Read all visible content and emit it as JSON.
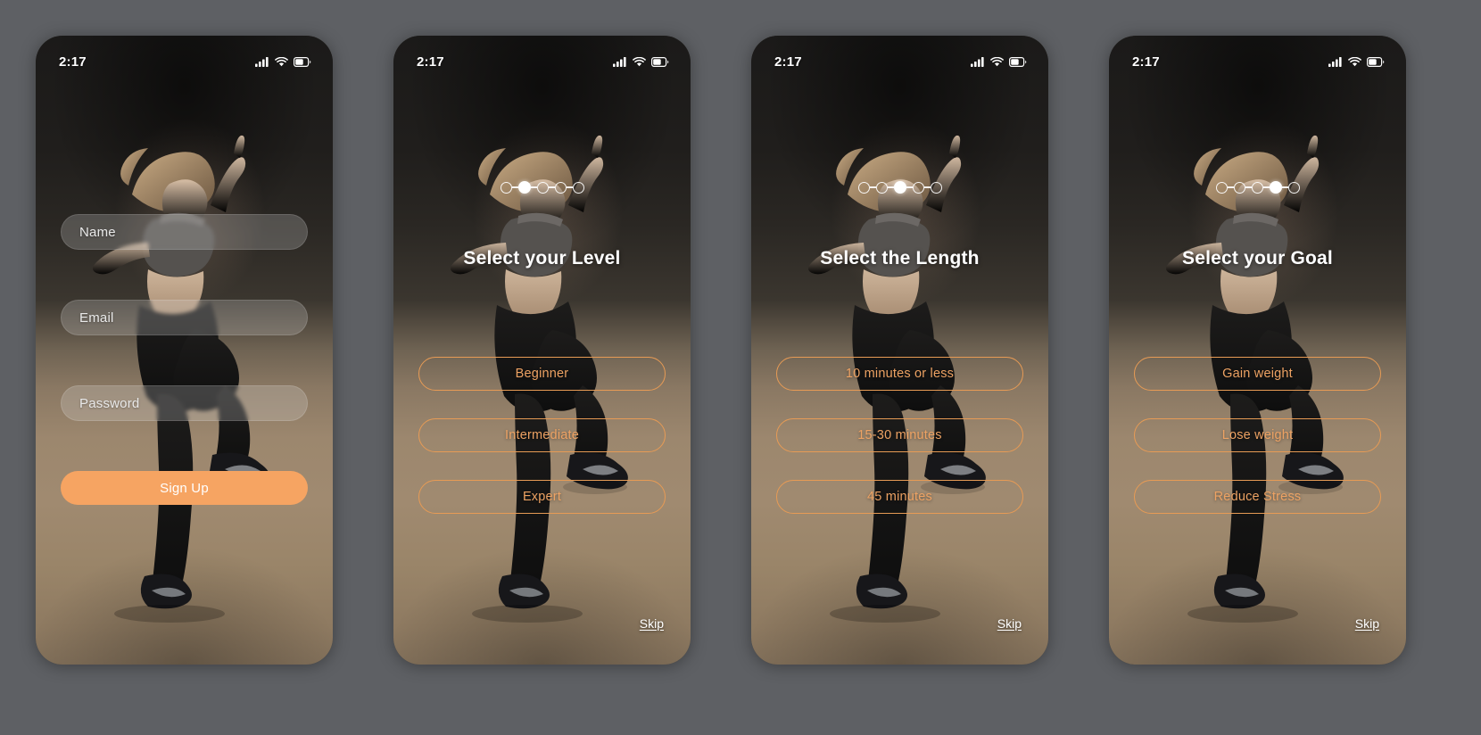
{
  "theme": {
    "accent": "#f6a462",
    "outline": "#e79b55",
    "option_text": "#eda263",
    "page_background": "#5e6064",
    "title_color": "#ffffff"
  },
  "status_bar": {
    "time": "2:17",
    "icons": [
      "cellular-signal-icon",
      "wifi-icon",
      "battery-icon"
    ]
  },
  "screens": [
    {
      "id": "signup",
      "kind": "form",
      "progress": null,
      "title": null,
      "fields": [
        {
          "name": "name-field",
          "placeholder": "Name",
          "value": ""
        },
        {
          "name": "email-field",
          "placeholder": "Email",
          "value": ""
        },
        {
          "name": "password-field",
          "placeholder": "Password",
          "value": ""
        }
      ],
      "primary_button": "Sign Up",
      "skip": null
    },
    {
      "id": "level",
      "kind": "choice",
      "progress": {
        "total": 5,
        "active_index": 1
      },
      "title": "Select your Level",
      "options": [
        "Beginner",
        "Intermediate",
        "Expert"
      ],
      "skip": "Skip"
    },
    {
      "id": "length",
      "kind": "choice",
      "progress": {
        "total": 5,
        "active_index": 2
      },
      "title": "Select the Length",
      "options": [
        "10 minutes or less",
        "15-30 minutes",
        "45 minutes"
      ],
      "skip": "Skip"
    },
    {
      "id": "goal",
      "kind": "choice",
      "progress": {
        "total": 5,
        "active_index": 3
      },
      "title": "Select your Goal",
      "options": [
        "Gain weight",
        "Lose weight",
        "Reduce Stress"
      ],
      "skip": "Skip"
    }
  ]
}
